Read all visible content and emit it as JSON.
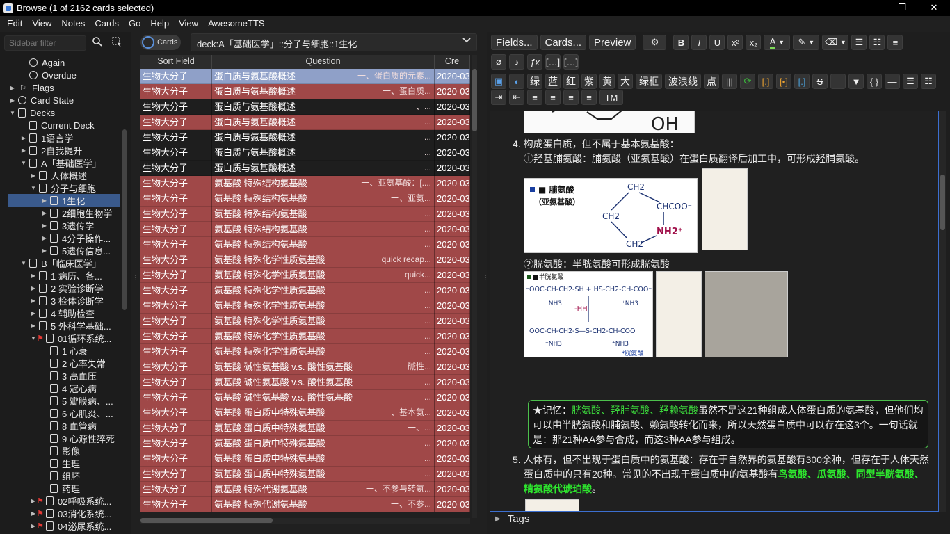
{
  "window": {
    "title": "Browse (1 of 2162 cards selected)",
    "minimize": "—",
    "maximize": "❐",
    "close": "✕"
  },
  "menu": [
    "Edit",
    "View",
    "Notes",
    "Cards",
    "Go",
    "Help",
    "View",
    "AwesomeTTS"
  ],
  "sidebar": {
    "filter_placeholder": "Sidebar filter",
    "items": [
      {
        "label": "Again",
        "icon": "clock-icon",
        "indent": 1,
        "arrow": ""
      },
      {
        "label": "Overdue",
        "icon": "clock-icon",
        "indent": 1,
        "arrow": ""
      },
      {
        "label": "Flags",
        "icon": "flag-icon",
        "indent": 0,
        "arrow": "▶"
      },
      {
        "label": "Card State",
        "icon": "circle-icon",
        "indent": 0,
        "arrow": "▶"
      },
      {
        "label": "Decks",
        "icon": "deck-icon",
        "indent": 0,
        "arrow": "▼"
      },
      {
        "label": "Current Deck",
        "icon": "deck-icon",
        "indent": 1,
        "arrow": ""
      },
      {
        "label": "1语言学",
        "icon": "deck-icon",
        "indent": 1,
        "arrow": "▶"
      },
      {
        "label": "2自我提升",
        "icon": "deck-icon",
        "indent": 1,
        "arrow": "▶"
      },
      {
        "label": "A「基础医学」",
        "icon": "deck-icon",
        "indent": 1,
        "arrow": "▼"
      },
      {
        "label": "人体概述",
        "icon": "deck-icon",
        "indent": 2,
        "arrow": "▶"
      },
      {
        "label": "分子与细胞",
        "icon": "deck-icon",
        "indent": 2,
        "arrow": "▼"
      },
      {
        "label": "1生化",
        "icon": "deck-icon",
        "indent": 3,
        "arrow": "▶",
        "selected": true
      },
      {
        "label": "2细胞生物学",
        "icon": "deck-icon",
        "indent": 3,
        "arrow": "▶"
      },
      {
        "label": "3遗传学",
        "icon": "deck-icon",
        "indent": 3,
        "arrow": "▶"
      },
      {
        "label": "4分子操作...",
        "icon": "deck-icon",
        "indent": 3,
        "arrow": "▶"
      },
      {
        "label": "5遗传信息...",
        "icon": "deck-icon",
        "indent": 3,
        "arrow": "▶"
      },
      {
        "label": "B「临床医学」",
        "icon": "deck-icon",
        "indent": 1,
        "arrow": "▼"
      },
      {
        "label": "1 病历、各...",
        "icon": "deck-icon",
        "indent": 2,
        "arrow": "▶"
      },
      {
        "label": "2 实验诊断学",
        "icon": "deck-icon",
        "indent": 2,
        "arrow": "▶"
      },
      {
        "label": "3 检体诊断学",
        "icon": "deck-icon",
        "indent": 2,
        "arrow": "▶"
      },
      {
        "label": "4 辅助检查",
        "icon": "deck-icon",
        "indent": 2,
        "arrow": "▶"
      },
      {
        "label": "5 外科学基础...",
        "icon": "deck-icon",
        "indent": 2,
        "arrow": "▶"
      },
      {
        "label": "01循环系统...",
        "icon": "deck-icon",
        "indent": 2,
        "arrow": "▼",
        "flag": true
      },
      {
        "label": "1 心衰",
        "icon": "deck-icon",
        "indent": 3,
        "arrow": ""
      },
      {
        "label": "2 心率失常",
        "icon": "deck-icon",
        "indent": 3,
        "arrow": ""
      },
      {
        "label": "3 高血压",
        "icon": "deck-icon",
        "indent": 3,
        "arrow": ""
      },
      {
        "label": "4 冠心病",
        "icon": "deck-icon",
        "indent": 3,
        "arrow": ""
      },
      {
        "label": "5 瓣膜病、...",
        "icon": "deck-icon",
        "indent": 3,
        "arrow": ""
      },
      {
        "label": "6 心肌炎、...",
        "icon": "deck-icon",
        "indent": 3,
        "arrow": ""
      },
      {
        "label": "8 血管病",
        "icon": "deck-icon",
        "indent": 3,
        "arrow": ""
      },
      {
        "label": "9 心源性猝死",
        "icon": "deck-icon",
        "indent": 3,
        "arrow": ""
      },
      {
        "label": "影像",
        "icon": "deck-icon",
        "indent": 3,
        "arrow": ""
      },
      {
        "label": "生理",
        "icon": "deck-icon",
        "indent": 3,
        "arrow": ""
      },
      {
        "label": "组胚",
        "icon": "deck-icon",
        "indent": 3,
        "arrow": ""
      },
      {
        "label": "药理",
        "icon": "deck-icon",
        "indent": 3,
        "arrow": ""
      },
      {
        "label": "02呼吸系统...",
        "icon": "deck-icon",
        "indent": 2,
        "arrow": "▶",
        "flag": true
      },
      {
        "label": "03消化系统...",
        "icon": "deck-icon",
        "indent": 2,
        "arrow": "▶",
        "flag": true
      },
      {
        "label": "04泌尿系统...",
        "icon": "deck-icon",
        "indent": 2,
        "arrow": "▶",
        "flag": true
      }
    ]
  },
  "browser": {
    "toggle_label": "Cards",
    "search_value": "deck:A「基础医学」::分子与细胞::1生化",
    "columns": [
      "Sort Field",
      "Question",
      "Cre"
    ],
    "rows": [
      {
        "sort": "生物大分子",
        "q": "蛋白质与氨基酸概述",
        "tail": "一、蛋白质的元素...",
        "date": "2020-03",
        "style": "sel"
      },
      {
        "sort": "生物大分子",
        "q": "蛋白质与氨基酸概述",
        "tail": "一、蛋白质...",
        "date": "2020-03",
        "style": "red"
      },
      {
        "sort": "生物大分子",
        "q": "蛋白质与氨基酸概述",
        "tail": "一、...",
        "date": "2020-03",
        "style": "dark"
      },
      {
        "sort": "生物大分子",
        "q": "蛋白质与氨基酸概述",
        "tail": "...",
        "date": "2020-03",
        "style": "red"
      },
      {
        "sort": "生物大分子",
        "q": "蛋白质与氨基酸概述",
        "tail": "...",
        "date": "2020-03",
        "style": "dark"
      },
      {
        "sort": "生物大分子",
        "q": "蛋白质与氨基酸概述",
        "tail": "...",
        "date": "2020-03",
        "style": "dark"
      },
      {
        "sort": "生物大分子",
        "q": "蛋白质与氨基酸概述",
        "tail": "...",
        "date": "2020-03",
        "style": "dark"
      },
      {
        "sort": "生物大分子",
        "q": "氨基酸 特殊结构氨基酸",
        "tail": "一、亚氨基酸：[....",
        "date": "2020-03",
        "style": "red"
      },
      {
        "sort": "生物大分子",
        "q": "氨基酸 特殊结构氨基酸",
        "tail": "一、亚氨...",
        "date": "2020-03",
        "style": "red"
      },
      {
        "sort": "生物大分子",
        "q": "氨基酸 特殊结构氨基酸",
        "tail": "一...",
        "date": "2020-03",
        "style": "red"
      },
      {
        "sort": "生物大分子",
        "q": "氨基酸 特殊结构氨基酸",
        "tail": "...",
        "date": "2020-03",
        "style": "red"
      },
      {
        "sort": "生物大分子",
        "q": "氨基酸 特殊结构氨基酸",
        "tail": "...",
        "date": "2020-03",
        "style": "red"
      },
      {
        "sort": "生物大分子",
        "q": "氨基酸 特殊化学性质氨基酸",
        "tail": "quick recap...",
        "date": "2020-03",
        "style": "red"
      },
      {
        "sort": "生物大分子",
        "q": "氨基酸 特殊化学性质氨基酸",
        "tail": "quick...",
        "date": "2020-03",
        "style": "red"
      },
      {
        "sort": "生物大分子",
        "q": "氨基酸 特殊化学性质氨基酸",
        "tail": "...",
        "date": "2020-03",
        "style": "red"
      },
      {
        "sort": "生物大分子",
        "q": "氨基酸 特殊化学性质氨基酸",
        "tail": "...",
        "date": "2020-03",
        "style": "red"
      },
      {
        "sort": "生物大分子",
        "q": "氨基酸 特殊化学性质氨基酸",
        "tail": "...",
        "date": "2020-03",
        "style": "red"
      },
      {
        "sort": "生物大分子",
        "q": "氨基酸 特殊化学性质氨基酸",
        "tail": "...",
        "date": "2020-03",
        "style": "red"
      },
      {
        "sort": "生物大分子",
        "q": "氨基酸 特殊化学性质氨基酸",
        "tail": "...",
        "date": "2020-03",
        "style": "red"
      },
      {
        "sort": "生物大分子",
        "q": "氨基酸 碱性氨基酸 v.s. 酸性氨基酸",
        "tail": "碱性...",
        "date": "2020-03",
        "style": "red"
      },
      {
        "sort": "生物大分子",
        "q": "氨基酸 碱性氨基酸 v.s. 酸性氨基酸",
        "tail": "...",
        "date": "2020-03",
        "style": "red"
      },
      {
        "sort": "生物大分子",
        "q": "氨基酸 碱性氨基酸 v.s. 酸性氨基酸",
        "tail": "...",
        "date": "2020-03",
        "style": "red"
      },
      {
        "sort": "生物大分子",
        "q": "氨基酸 蛋白质中特殊氨基酸",
        "tail": "一、基本氨...",
        "date": "2020-03",
        "style": "red"
      },
      {
        "sort": "生物大分子",
        "q": "氨基酸 蛋白质中特殊氨基酸",
        "tail": "一、...",
        "date": "2020-03",
        "style": "red"
      },
      {
        "sort": "生物大分子",
        "q": "氨基酸 蛋白质中特殊氨基酸",
        "tail": "...",
        "date": "2020-03",
        "style": "red"
      },
      {
        "sort": "生物大分子",
        "q": "氨基酸 蛋白质中特殊氨基酸",
        "tail": "...",
        "date": "2020-03",
        "style": "red"
      },
      {
        "sort": "生物大分子",
        "q": "氨基酸 蛋白质中特殊氨基酸",
        "tail": "...",
        "date": "2020-03",
        "style": "red"
      },
      {
        "sort": "生物大分子",
        "q": "氨基酸 特殊代谢氨基酸",
        "tail": "一、不参与转氨...",
        "date": "2020-03",
        "style": "red"
      },
      {
        "sort": "生物大分子",
        "q": "氨基酸 特殊代谢氨基酸",
        "tail": "一、不参...",
        "date": "2020-03",
        "style": "red"
      }
    ]
  },
  "editor": {
    "fields_btn": "Fields...",
    "cards_btn": "Cards...",
    "preview_btn": "Preview",
    "format_row1": [
      "B",
      "I",
      "U",
      "x²",
      "x₂"
    ],
    "custom_row": [
      "绿",
      "蓝",
      "红",
      "紫",
      "黄",
      "大",
      "绿框",
      "波浪线",
      "点"
    ],
    "tm_btn": "TM",
    "tags_label": "Tags"
  },
  "note": {
    "item4_title": "4. 构成蛋白质，但不属于基本氨基酸：",
    "item4_sub1": "①羟基脯氨酸：脯氨酸（亚氨基酸）在蛋白质翻译后加工中，可形成羟脯氨酸。",
    "img_proline_label1": "■ 脯氨酸",
    "img_proline_label2": "（亚氨基酸）",
    "img_proline_ch2": "CH2",
    "img_proline_chcoo": "CHCOO⁻",
    "img_proline_nh2": "NH2⁺",
    "img_oh": "OH",
    "item4_sub2": "②胱氨酸：半胱氨酸可形成胱氨酸",
    "img_cys_label": "■半胱氨酸",
    "img_cys_top": "⁻OOC-CH-CH2-SH + HS-CH2-CH-COO⁻",
    "img_cys_nh3": "⁺NH3",
    "img_cys_hh": "-HH",
    "img_cys_bottom": "⁻OOC-CH-CH2-S—S-CH2-CH-COO⁻",
    "img_cys_foot": "*胱氨酸",
    "callout_star": "★记忆：",
    "callout_green": "胱氨酸、羟脯氨酸、羟赖氨酸",
    "callout_rest": "虽然不是这21种组成人体蛋白质的氨基酸，但他们均可以由半胱氨酸和脯氨酸、赖氨酸转化而来，所以天然蛋白质中可以存在这3个。一句话就是：那21种AA参与合成，而这3种AA参与组成。",
    "item5_line1": "5. 人体有，但不出现于蛋白质中的氨基酸：存在于自然界的氨基酸有300余种，但存在于人体天然",
    "item5_line2a": "蛋白质中的只有20种。常见的不出现于蛋白质中的氨基酸有",
    "item5_green1": "鸟氨酸、瓜氨酸、同型半胱氨酸、",
    "item5_green2": "精氨酸代琥珀酸",
    "item5_end": "。"
  },
  "colors": {
    "row_red": "#a04848",
    "row_selected": "#8fa0c8",
    "accent_blue": "#3c6fd0",
    "highlight_green": "#2ee82e"
  }
}
